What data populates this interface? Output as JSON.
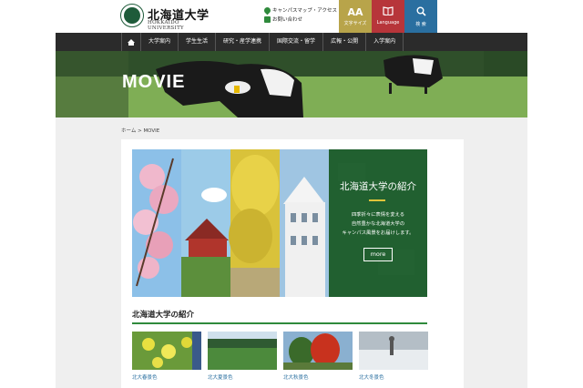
{
  "header": {
    "logo_jp": "北海道大学",
    "logo_en": "HOKKAIDO UNIVERSITY",
    "links": [
      {
        "label": "キャンパスマップ・アクセス",
        "icon": "map-pin-icon"
      },
      {
        "label": "お問い合わせ",
        "icon": "mail-icon"
      }
    ],
    "buttons": {
      "font_size": {
        "glyph": "AA",
        "label": "文字サイズ"
      },
      "language": {
        "label": "Language"
      },
      "search": {
        "label": "検 索"
      }
    }
  },
  "nav": {
    "home_icon": "home-icon",
    "items": [
      "大学案内",
      "学生生活",
      "研究・産学連携",
      "国際交流・留学",
      "広報・公開",
      "入学案内"
    ]
  },
  "hero": {
    "title": "MOVIE"
  },
  "breadcrumb": "ホーム > MOVIE",
  "banner": {
    "title": "北海道大学の紹介",
    "text_lines": [
      "四季折々に表情を変える",
      "自然豊かな北海道大学の",
      "キャンパス風景をお届けします。"
    ],
    "more": "more"
  },
  "section": {
    "title": "北海道大学の紹介",
    "videos": [
      {
        "caption": "北大春景色"
      },
      {
        "caption": "北大夏景色"
      },
      {
        "caption": "北大秋景色"
      },
      {
        "caption": "北大冬景色"
      }
    ]
  },
  "colors": {
    "accent_green": "#2f8a3c",
    "nav_bg": "#2b2b2b",
    "font_btn": "#b8a44a",
    "lang_btn": "#b7353a",
    "search_btn": "#2a6fa0"
  }
}
